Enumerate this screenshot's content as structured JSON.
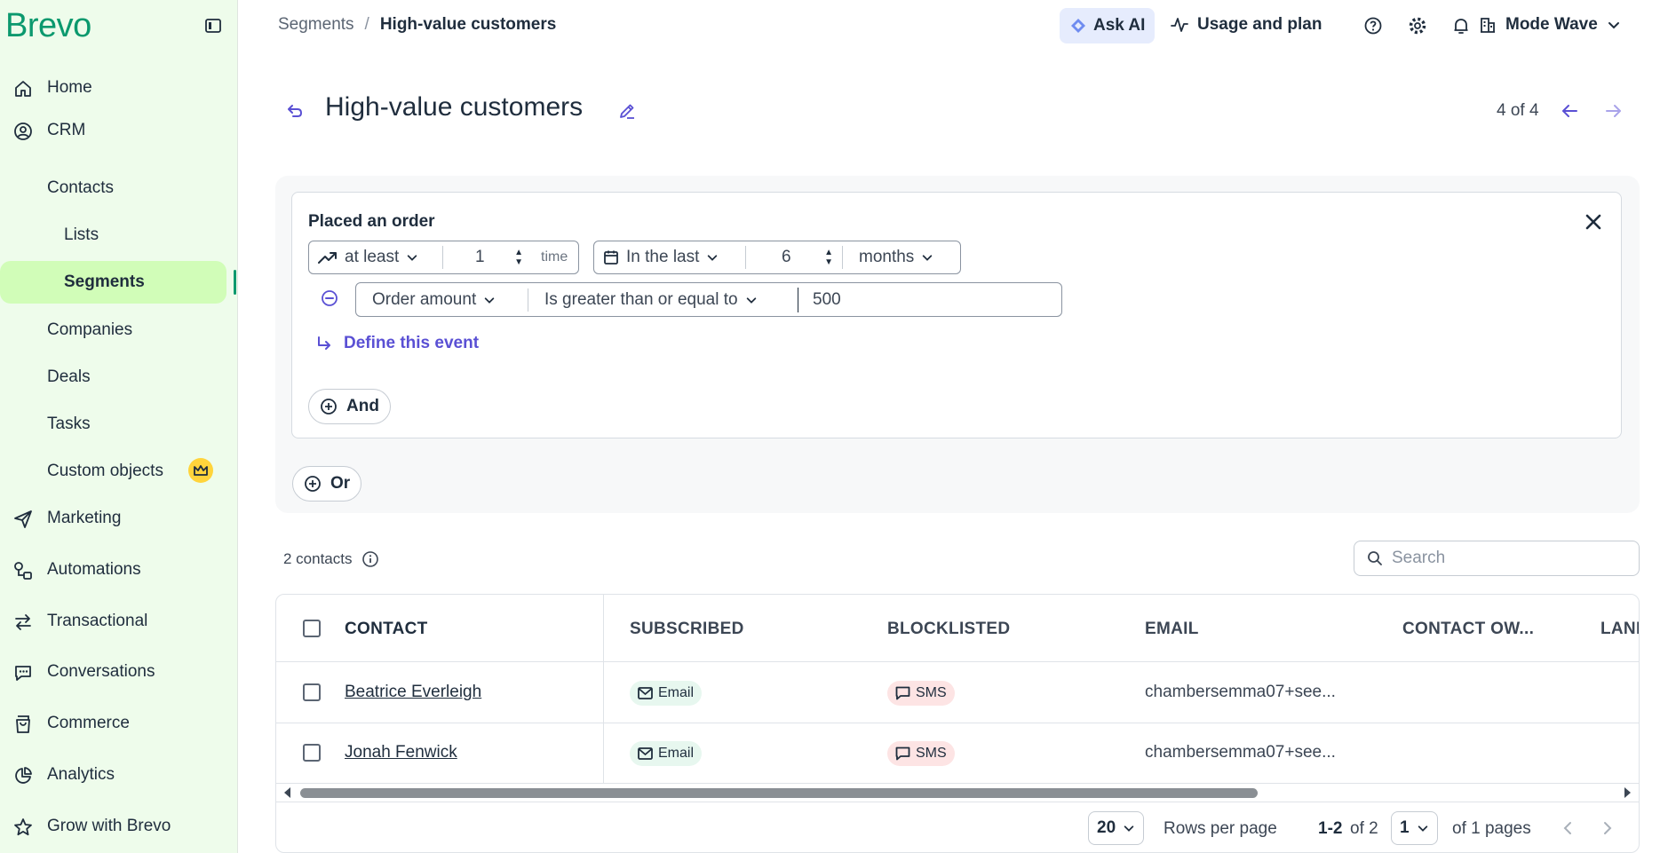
{
  "app": {
    "logo": "Brevo"
  },
  "sidebar": {
    "items": [
      {
        "label": "Home",
        "icon": "home-icon"
      },
      {
        "label": "CRM",
        "icon": "crm-icon"
      },
      {
        "label": "Marketing",
        "icon": "send-icon"
      },
      {
        "label": "Automations",
        "icon": "automations-icon"
      },
      {
        "label": "Transactional",
        "icon": "transactional-icon"
      },
      {
        "label": "Conversations",
        "icon": "chat-icon"
      },
      {
        "label": "Commerce",
        "icon": "bag-icon"
      },
      {
        "label": "Analytics",
        "icon": "pie-chart-icon"
      },
      {
        "label": "Grow with Brevo",
        "icon": "star-icon"
      }
    ],
    "crm_sub": [
      "Contacts",
      "Lists",
      "Segments",
      "Companies",
      "Deals",
      "Tasks",
      "Custom objects"
    ],
    "active": "Segments"
  },
  "topbar": {
    "breadcrumb": [
      "Segments",
      "/",
      "High-value customers"
    ],
    "ask_ai": "Ask AI",
    "usage": "Usage and plan",
    "account": "Mode Wave"
  },
  "page": {
    "title": "High-value customers",
    "pager": "4 of 4"
  },
  "condition": {
    "title": "Placed an order",
    "frequency_op": "at least",
    "frequency_value": "1",
    "frequency_unit": "time",
    "period_op": "In the last",
    "period_value": "6",
    "period_unit": "months",
    "filter_field": "Order amount",
    "filter_op": "Is greater than or equal to",
    "filter_value": "500",
    "define_link": "Define this event",
    "and_label": "And",
    "or_label": "Or"
  },
  "contacts": {
    "count_label": "2 contacts",
    "search_placeholder": "Search",
    "columns": [
      "CONTACT",
      "SUBSCRIBED",
      "BLOCKLISTED",
      "EMAIL",
      "CONTACT OW...",
      "LAND"
    ],
    "rows": [
      {
        "name": "Beatrice Everleigh",
        "subscribed": "Email",
        "blocklisted": "SMS",
        "email": "chambersemma07+see..."
      },
      {
        "name": "Jonah Fenwick",
        "subscribed": "Email",
        "blocklisted": "SMS",
        "email": "chambersemma07+see..."
      }
    ],
    "footer": {
      "rows_per_page_value": "20",
      "rows_per_page_label": "Rows per page",
      "range_bold": "1-2",
      "range_rest": "of 2",
      "page_value": "1",
      "page_total": "of 1 pages"
    }
  },
  "colors": {
    "brand": "#0b996e",
    "sidebar_bg": "#eefceb",
    "active_bg": "#d1fdb8",
    "link": "#5a50d4"
  }
}
